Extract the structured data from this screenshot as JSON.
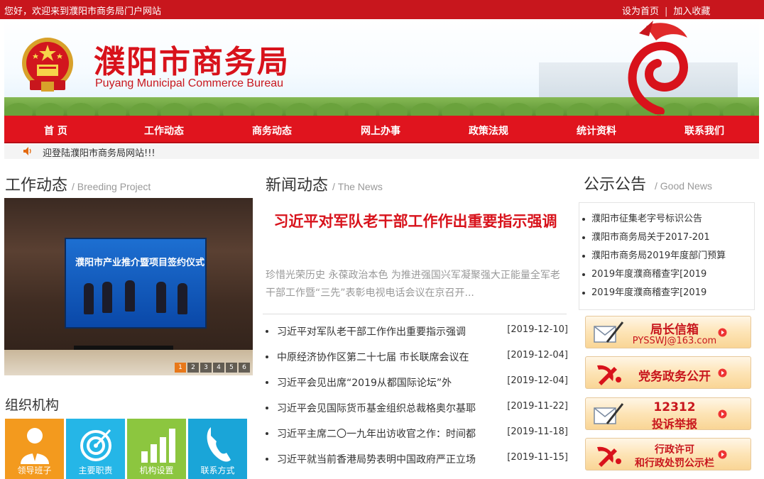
{
  "topbar": {
    "welcome": "您好，欢迎来到濮阳市商务局门户网站",
    "set_home": "设为首页",
    "divider": "|",
    "add_fav": "加入收藏"
  },
  "banner": {
    "title_cn": "濮阳市商务局",
    "title_en": "Puyang Municipal Commerce Bureau"
  },
  "nav": {
    "items": [
      "首 页",
      "工作动态",
      "商务动态",
      "网上办事",
      "政策法规",
      "统计资料",
      "联系我们"
    ]
  },
  "marquee": {
    "text": "迎登陆濮阳市商务局网站!!!"
  },
  "work": {
    "title": "工作动态",
    "subtitle": "/ Breeding Project",
    "photo_caption": "濮阳市产业推介暨项目签约仪式",
    "pager": [
      "1",
      "2",
      "3",
      "4",
      "5",
      "6"
    ]
  },
  "org": {
    "title": "组织机构",
    "tiles": [
      {
        "label": "领导班子",
        "color": "#f39a1e"
      },
      {
        "label": "主要职责",
        "color": "#25b6e7"
      },
      {
        "label": "机构设置",
        "color": "#8cc63f"
      },
      {
        "label": "联系方式",
        "color": "#1aa5d8"
      }
    ]
  },
  "news": {
    "title": "新闻动态",
    "subtitle": "/ The News",
    "headline": "习近平对军队老干部工作作出重要指示强调",
    "summary": "珍惜光荣历史 永葆政治本色 为推进强国兴军凝聚强大正能量全军老干部工作暨“三先”表彰电视电话会议在京召开...",
    "items": [
      {
        "title": "习近平对军队老干部工作作出重要指示强调",
        "date": "[2019-12-10]"
      },
      {
        "title": "中原经济协作区第二十七届 市长联席会议在",
        "date": "[2019-12-04]"
      },
      {
        "title": "习近平会见出席“2019从都国际论坛”外",
        "date": "[2019-12-04]"
      },
      {
        "title": "习近平会见国际货币基金组织总裁格奥尔基耶",
        "date": "[2019-11-22]"
      },
      {
        "title": "习近平主席二〇一九年出访收官之作：时间都",
        "date": "[2019-11-18]"
      },
      {
        "title": "习近平就当前香港局势表明中国政府严正立场",
        "date": "[2019-11-15]"
      }
    ]
  },
  "notices": {
    "title": "公示公告",
    "subtitle": "/ Good News",
    "items": [
      "濮阳市征集老字号标识公告",
      "濮阳市商务局关于2017-201",
      "濮阳市商务局2019年度部门预算",
      "2019年度濮商稽查字[2019",
      "2019年度濮商稽查字[2019"
    ]
  },
  "side_buttons": [
    {
      "line1": "局长信箱",
      "line2": "PYSSWJ@163.com",
      "icon": "mail-pen-icon"
    },
    {
      "line1": "党务政务公开",
      "line2": "",
      "icon": "party-emblem-icon"
    },
    {
      "line1": "12312",
      "line2": "投诉举报",
      "icon": "mail-pen-icon"
    },
    {
      "line1": "行政许可",
      "line2": "和行政处罚公示栏",
      "icon": "party-emblem-icon"
    }
  ],
  "colors": {
    "brand_red": "#c8161d",
    "nav_red": "#e0141e",
    "headline_red": "#d8121b"
  }
}
